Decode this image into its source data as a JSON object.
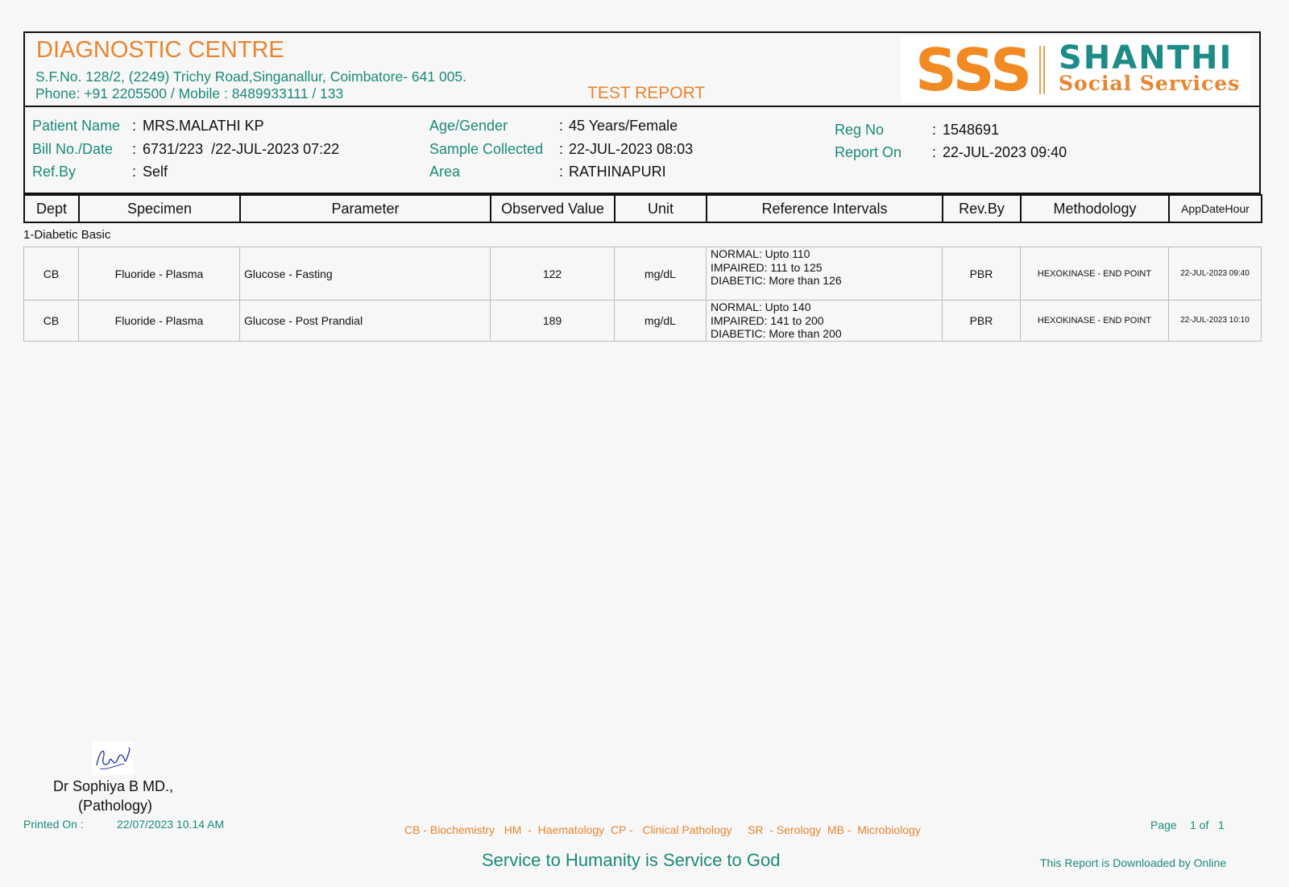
{
  "header": {
    "centre_name": "DIAGNOSTIC CENTRE",
    "address": "S.F.No. 128/2, (2249) Trichy Road,Singanallur, Coimbatore- 641 005.",
    "phone": "Phone: +91 2205500 / Mobile : 8489933111 / 133",
    "report_title": "TEST REPORT",
    "logo": {
      "mark": "SSS",
      "name": "SHANTHI",
      "tagline": "Social Services"
    }
  },
  "patient": {
    "name_label": "Patient Name",
    "name_value": "MRS.MALATHI KP",
    "bill_label": "Bill No./Date",
    "bill_value": "6731/223  /22-JUL-2023 07:22",
    "ref_label": "Ref.By",
    "ref_value": "Self",
    "age_label": "Age/Gender",
    "age_value": "45 Years/Female",
    "sample_label": "Sample Collected",
    "sample_value": "22-JUL-2023 08:03",
    "area_label": "Area",
    "area_value": "RATHINAPURI",
    "reg_label": "Reg No",
    "reg_value": "1548691",
    "report_on_label": "Report On",
    "report_on_value": "22-JUL-2023 09:40",
    "colon": ":"
  },
  "table": {
    "headers": [
      "Dept",
      "Specimen",
      "Parameter",
      "Observed Value",
      "Unit",
      "Reference Intervals",
      "Rev.By",
      "Methodology",
      "AppDateHour"
    ],
    "section": "1-Diabetic Basic",
    "rows": [
      {
        "dept": "CB",
        "specimen": "Fluoride - Plasma",
        "parameter": "Glucose - Fasting",
        "value": "122",
        "unit": "mg/dL",
        "ref": [
          "NORMAL: Upto 110",
          "IMPAIRED: 111 to 125",
          "DIABETIC: More than 126"
        ],
        "rev_by": "PBR",
        "method": "HEXOKINASE - END POINT",
        "date": "22-JUL-2023 09:40"
      },
      {
        "dept": "CB",
        "specimen": "Fluoride - Plasma",
        "parameter": "Glucose - Post Prandial",
        "value": "189",
        "unit": "mg/dL",
        "ref": [
          "NORMAL: Upto 140",
          "IMPAIRED: 141 to 200",
          "DIABETIC: More than 200"
        ],
        "rev_by": "PBR",
        "method": "HEXOKINASE - END POINT",
        "date": "22-JUL-2023 10:10"
      }
    ]
  },
  "footer": {
    "doctor_name": "Dr Sophiya B MD.,",
    "doctor_dept": "(Pathology)",
    "printed_label": "Printed On :",
    "printed_value": "22/07/2023 10.14 AM",
    "legend": "CB - Biochemistry   HM  -  Haematology  CP -   Clinical Pathology     SR  - Serology  MB -  Microbiology",
    "page_label": "Page",
    "page_value": "1 of   1",
    "motto": "Service to Humanity is Service to God",
    "download_note": "This Report is Downloaded by Online"
  },
  "colors": {
    "orange": "#e8852f",
    "teal": "#1a8a7a",
    "logo_teal": "#1d8c86",
    "logo_orange": "#f28a23"
  }
}
